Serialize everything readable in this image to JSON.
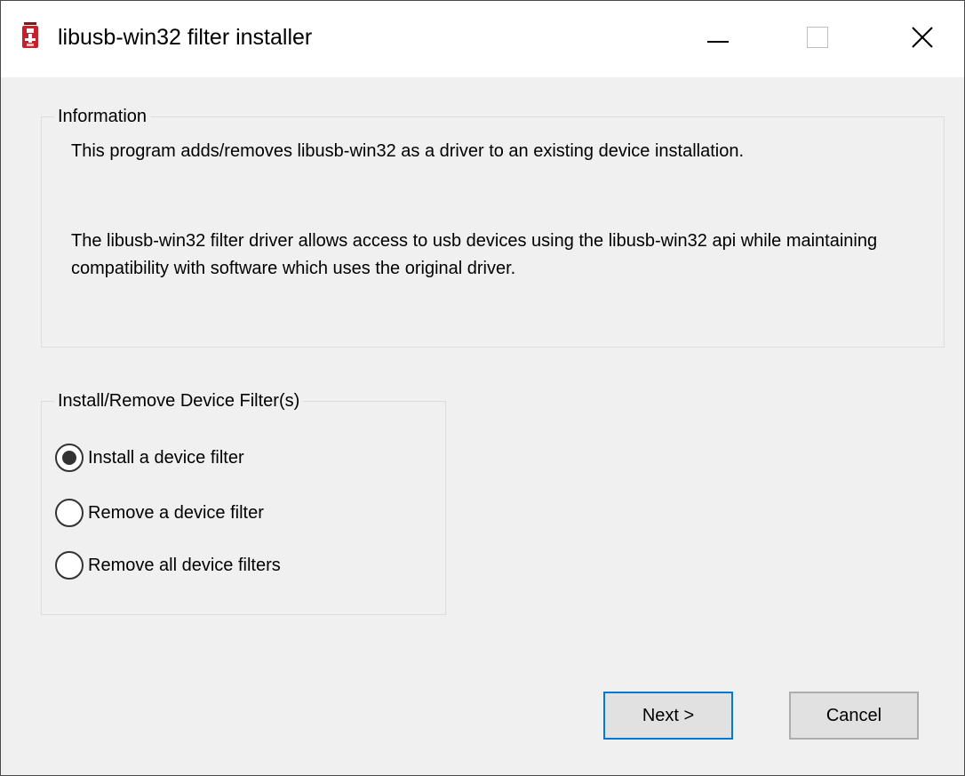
{
  "window": {
    "title": "libusb-win32 filter installer",
    "icon": "libusb-app-icon",
    "controls": [
      "minimize-icon",
      "maximize-icon",
      "close-icon"
    ]
  },
  "information": {
    "legend": "Information",
    "paragraph1": "This program adds/removes libusb-win32 as a driver to an existing device installation.",
    "paragraph2": "The libusb-win32 filter driver allows access to usb devices using the libusb-win32 api while maintaining compatibility with software which uses the original driver."
  },
  "filters": {
    "legend": "Install/Remove Device Filter(s)",
    "options": [
      {
        "label": "Install a device filter",
        "selected": true
      },
      {
        "label": "Remove a device filter",
        "selected": false
      },
      {
        "label": "Remove all device filters",
        "selected": false
      }
    ]
  },
  "buttons": {
    "next": "Next >",
    "cancel": "Cancel"
  },
  "colors": {
    "accent": "#0078d7",
    "window_bg": "#f0f0f0",
    "titlebar_bg": "#ffffff",
    "button_bg": "#e1e1e1"
  }
}
